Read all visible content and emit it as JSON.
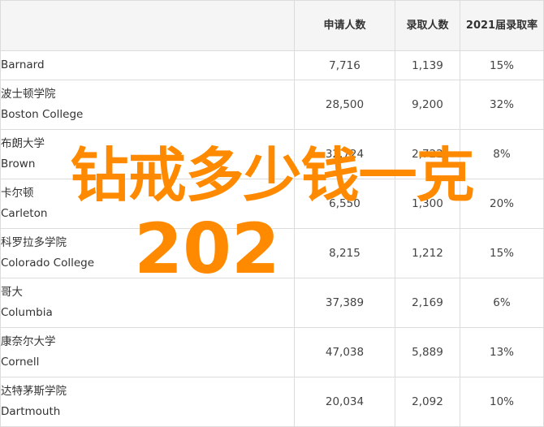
{
  "table": {
    "headers": [
      "",
      "申请人数",
      "录取人数",
      "2021届录取率"
    ],
    "rows": [
      {
        "zh": "",
        "en": "Barnard",
        "applicants": "7,716",
        "admitted": "1,139",
        "rate": "15%"
      },
      {
        "zh": "波士顿学院",
        "en": "Boston College",
        "applicants": "28,500",
        "admitted": "9,200",
        "rate": "32%"
      },
      {
        "zh": "布朗大学",
        "en": "Brown",
        "applicants": "32,724",
        "admitted": "2,722",
        "rate": "8%"
      },
      {
        "zh": "卡尔顿",
        "en": "Carleton",
        "applicants": "6,550",
        "admitted": "1,300",
        "rate": "20%"
      },
      {
        "zh": "科罗拉多学院",
        "en": "Colorado College",
        "applicants": "8,215",
        "admitted": "1,212",
        "rate": "15%"
      },
      {
        "zh": "哥大",
        "en": "Columbia",
        "applicants": "37,389",
        "admitted": "2,169",
        "rate": "6%"
      },
      {
        "zh": "康奈尔大学",
        "en": "Cornell",
        "applicants": "47,038",
        "admitted": "5,889",
        "rate": "13%"
      },
      {
        "zh": "达特茅斯学院",
        "en": "Dartmouth",
        "applicants": "20,034",
        "admitted": "2,092",
        "rate": "10%"
      }
    ]
  },
  "watermark": {
    "line1": "钻戒多少钱一克",
    "line2": "202",
    "color": "#ff8a00"
  }
}
